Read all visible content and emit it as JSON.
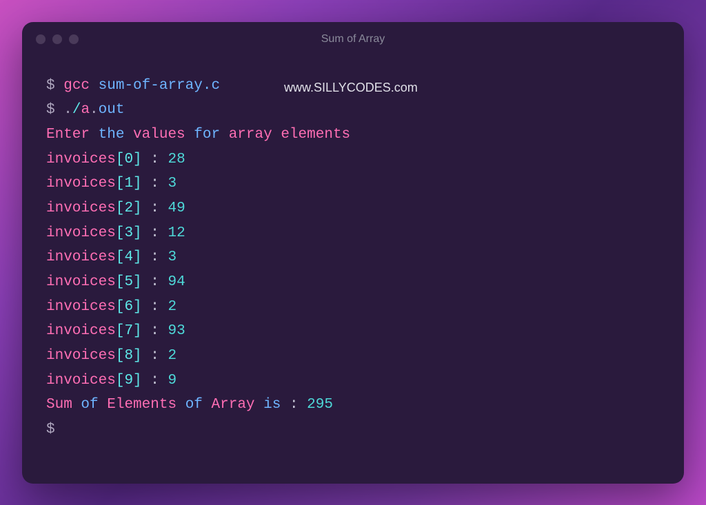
{
  "window": {
    "title": "Sum of Array"
  },
  "watermark": "www.SILLYCODES.com",
  "commands": {
    "prompt": "$",
    "compile_cmd": "gcc",
    "source_file": "sum-of-array.c",
    "dot": ".",
    "slash": "/",
    "exe_a": "a",
    "exe_out": "out"
  },
  "output": {
    "prompt_line": "Enter the values for array elements",
    "prompt_word1": "Enter",
    "prompt_word2": "the",
    "prompt_word3": "values",
    "prompt_word4": "for",
    "prompt_word5": "array",
    "prompt_word6": "elements",
    "array_name": "invoices",
    "entries": [
      {
        "index": "0",
        "value": "28"
      },
      {
        "index": "1",
        "value": "3"
      },
      {
        "index": "2",
        "value": "49"
      },
      {
        "index": "3",
        "value": "12"
      },
      {
        "index": "4",
        "value": "3"
      },
      {
        "index": "5",
        "value": "94"
      },
      {
        "index": "6",
        "value": "2"
      },
      {
        "index": "7",
        "value": "93"
      },
      {
        "index": "8",
        "value": "2"
      },
      {
        "index": "9",
        "value": "9"
      }
    ],
    "result_word1": "Sum",
    "result_word2": "of",
    "result_word3": "Elements",
    "result_word4": "of",
    "result_word5": "Array",
    "result_word6": "is",
    "result_colon": " : ",
    "result_value": "295"
  }
}
